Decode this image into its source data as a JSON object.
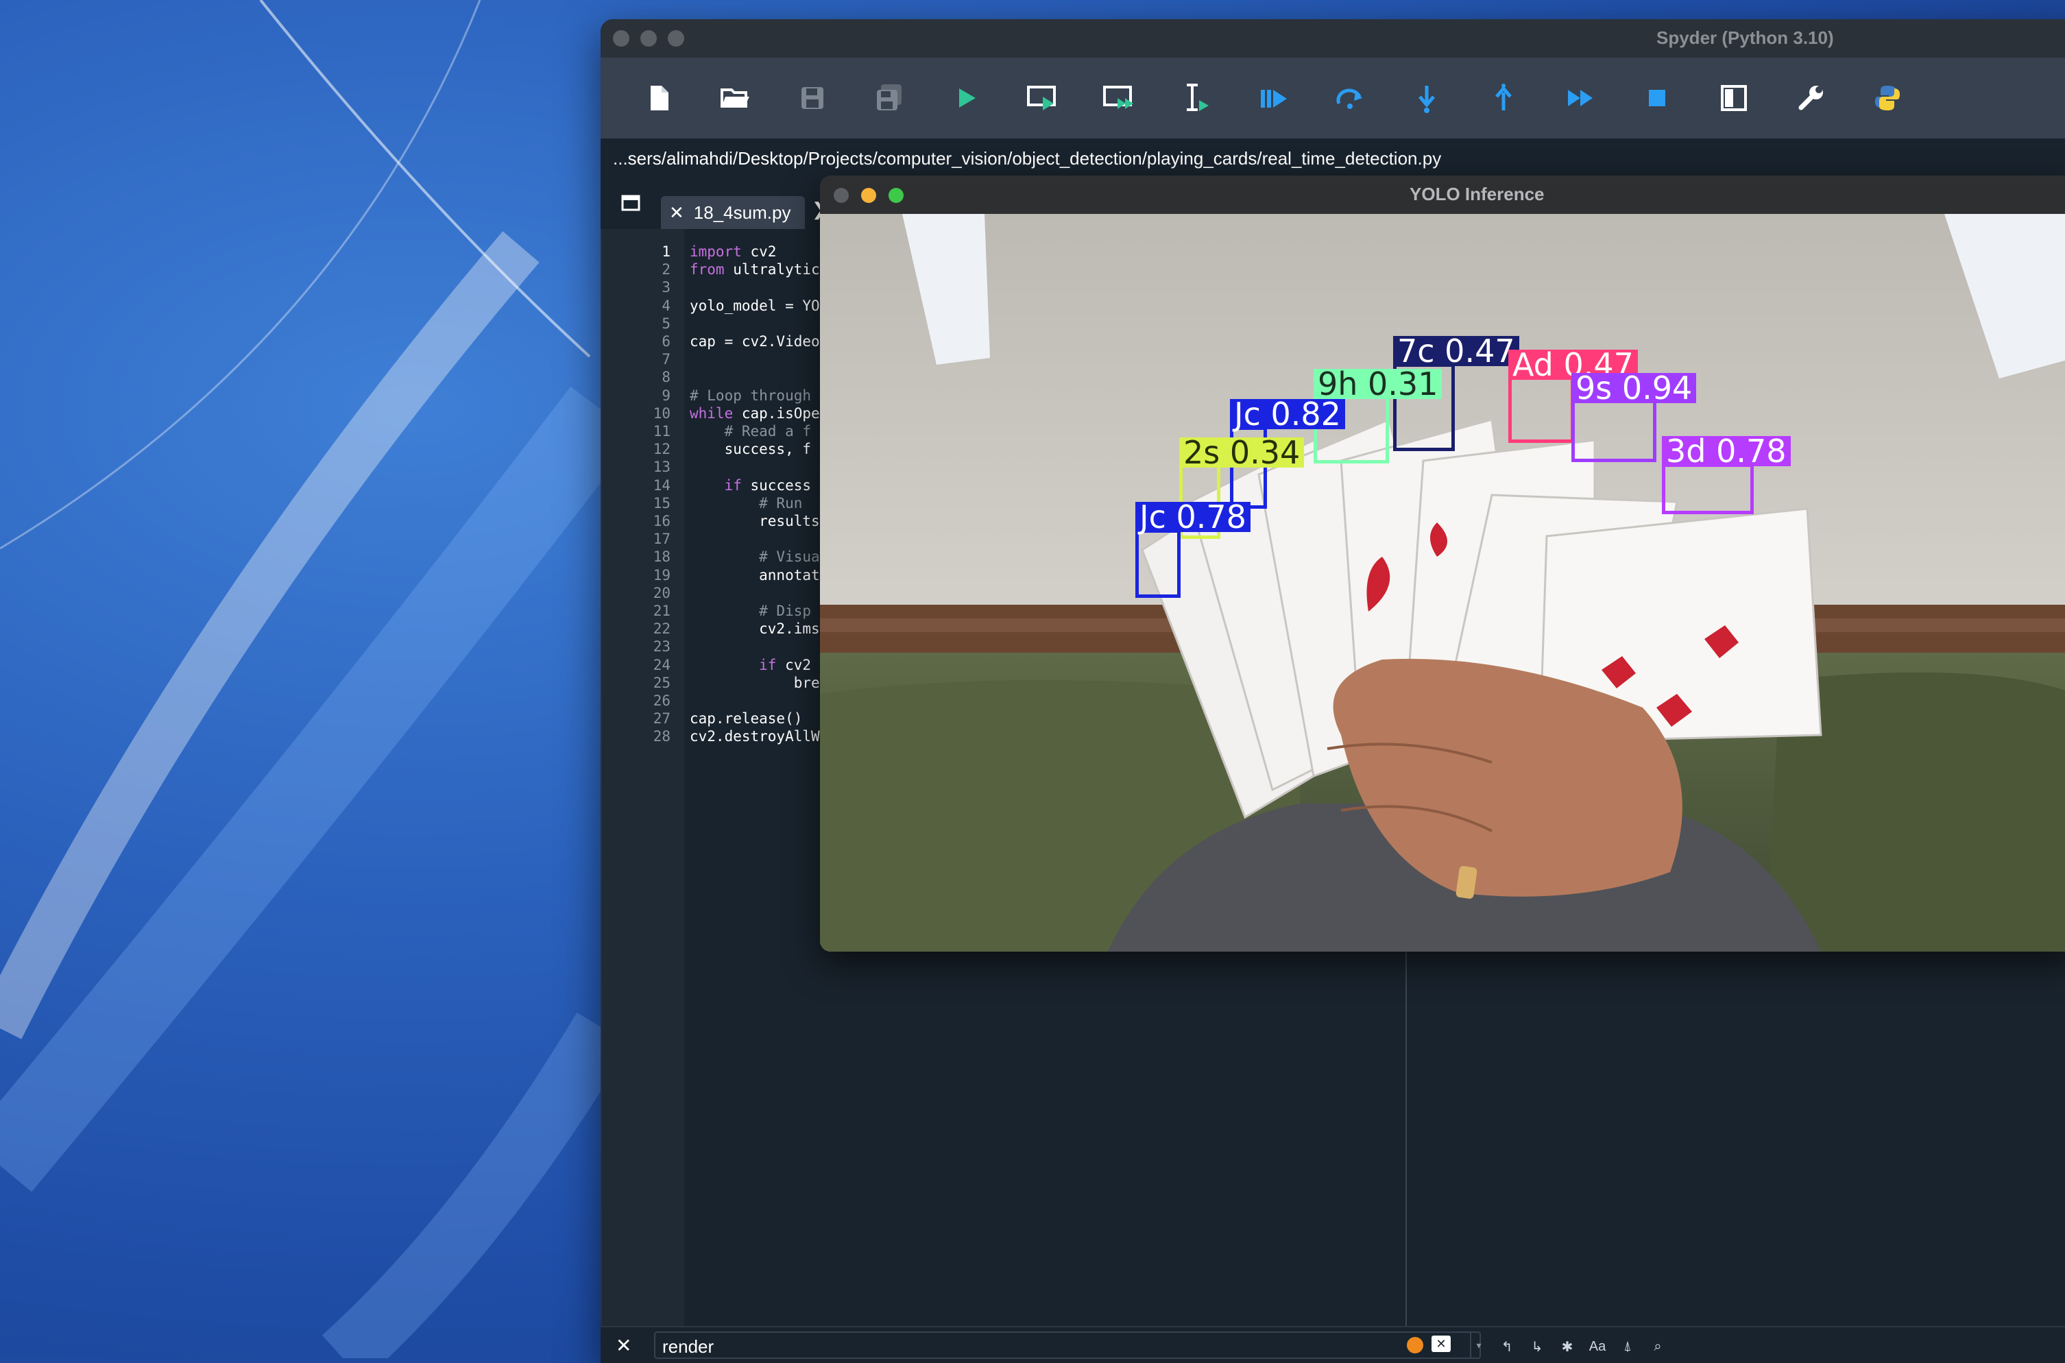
{
  "spyder": {
    "title": "Spyder (Python 3.10)",
    "path": "...sers/alimahdi/Desktop/Projects/computer_vision/object_detection/playing_cards/real_time_detection.py",
    "tabs": [
      {
        "label": "18_4sum.py"
      }
    ],
    "toolbar_icons": [
      "new-file-icon",
      "open-folder-icon",
      "save-icon",
      "save-all-icon",
      "run-icon",
      "run-cell-icon",
      "run-cell-advance-icon",
      "run-selection-icon",
      "debug-icon",
      "step-icon",
      "step-into-icon",
      "step-return-icon",
      "continue-icon",
      "stop-icon",
      "maximize-pane-icon",
      "preferences-wrench-icon",
      "python-path-icon"
    ],
    "code_lines": [
      {
        "n": "1",
        "t": "import cv2"
      },
      {
        "n": "2",
        "t": "from ultralytic"
      },
      {
        "n": "3",
        "t": ""
      },
      {
        "n": "4",
        "t": "yolo_model = YO"
      },
      {
        "n": "5",
        "t": ""
      },
      {
        "n": "6",
        "t": "cap = cv2.Video"
      },
      {
        "n": "7",
        "t": ""
      },
      {
        "n": "8",
        "t": ""
      },
      {
        "n": "9",
        "t": "# Loop through"
      },
      {
        "n": "10",
        "t": "while cap.isOpe"
      },
      {
        "n": "11",
        "t": "    # Read a f"
      },
      {
        "n": "12",
        "t": "    success, f"
      },
      {
        "n": "13",
        "t": ""
      },
      {
        "n": "14",
        "t": "    if success"
      },
      {
        "n": "15",
        "t": "        # Run"
      },
      {
        "n": "16",
        "t": "        results"
      },
      {
        "n": "17",
        "t": ""
      },
      {
        "n": "18",
        "t": "        # Visua"
      },
      {
        "n": "19",
        "t": "        annotat"
      },
      {
        "n": "20",
        "t": ""
      },
      {
        "n": "21",
        "t": "        # Disp"
      },
      {
        "n": "22",
        "t": "        cv2.ims"
      },
      {
        "n": "23",
        "t": ""
      },
      {
        "n": "24",
        "t": "        if cv2"
      },
      {
        "n": "25",
        "t": "            bre"
      },
      {
        "n": "26",
        "t": ""
      },
      {
        "n": "27",
        "t": "cap.release()"
      },
      {
        "n": "28",
        "t": "cv2.destroyAllW"
      }
    ],
    "find": {
      "value": "render"
    }
  },
  "yolo": {
    "title": "YOLO Inference",
    "detections": [
      {
        "label": "7c 0.47",
        "color": "#1a1f6b"
      },
      {
        "label": "Ad 0.47",
        "color": "#ff3b7a"
      },
      {
        "label": "9h 0.31",
        "color": "#7dffb0"
      },
      {
        "label": "9s 0.94",
        "color": "#a03cff"
      },
      {
        "label": "Jc 0.82",
        "color": "#1a24e0"
      },
      {
        "label": "2s 0.34",
        "color": "#d8f24a"
      },
      {
        "label": "3d 0.78",
        "color": "#b63cff"
      },
      {
        "label": "Jc 0.78",
        "color": "#1a24e0"
      }
    ]
  }
}
